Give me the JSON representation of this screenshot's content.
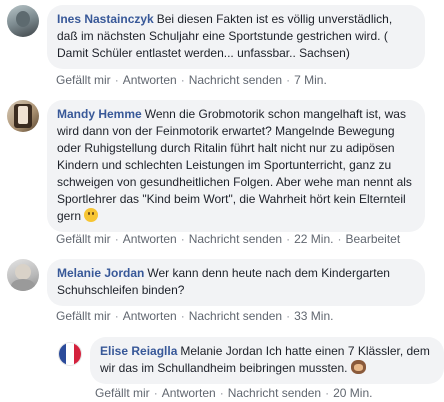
{
  "comments": [
    {
      "author": "Ines Nastainczyk",
      "text": "Bei diesen Fakten ist es völlig unverstädlich, daß im nächsten Schuljahr eine Sportstunde gestrichen wird. ( Damit Schüler entlastet werden... unfassbar.. Sachsen)",
      "actions": {
        "like": "Gefällt mir",
        "reply": "Antworten",
        "message": "Nachricht senden",
        "time": "7 Min."
      }
    },
    {
      "author": "Mandy Hemme",
      "text": "Wenn die Grobmotorik schon mangelhaft ist, was wird dann von der Feinmotorik erwartet? Mangelnde Bewegung oder Ruhigstellung durch Ritalin führt halt nicht nur zu adipösen Kindern und schlechten Leistungen im Sportunterricht, ganz zu schweigen von gesundheitlichen Folgen. Aber wehe man nennt als Sportlehrer das \"Kind beim Wort\", die Wahrheit hört kein Elternteil gern",
      "emoji": "smiling-face-emoji",
      "actions": {
        "like": "Gefällt mir",
        "reply": "Antworten",
        "message": "Nachricht senden",
        "time": "22 Min.",
        "edited": "Bearbeitet"
      }
    },
    {
      "author": "Melanie Jordan",
      "text": "Wer kann denn heute nach dem Kindergarten Schuhschleifen binden?",
      "actions": {
        "like": "Gefällt mir",
        "reply": "Antworten",
        "message": "Nachricht senden",
        "time": "33 Min."
      }
    }
  ],
  "reply": {
    "author": "Elise Reiaglla",
    "text": "Melanie Jordan Ich hatte einen 7 Klässler, dem wir das im Schullandheim beibringen mussten.",
    "emoji": "see-no-evil-monkey-emoji",
    "actions": {
      "like": "Gefällt mir",
      "reply": "Antworten",
      "message": "Nachricht senden",
      "time": "20 Min."
    }
  },
  "colors": {
    "author_link": "#385898",
    "bubble_bg": "#f2f3f5",
    "action_text": "#606770"
  }
}
